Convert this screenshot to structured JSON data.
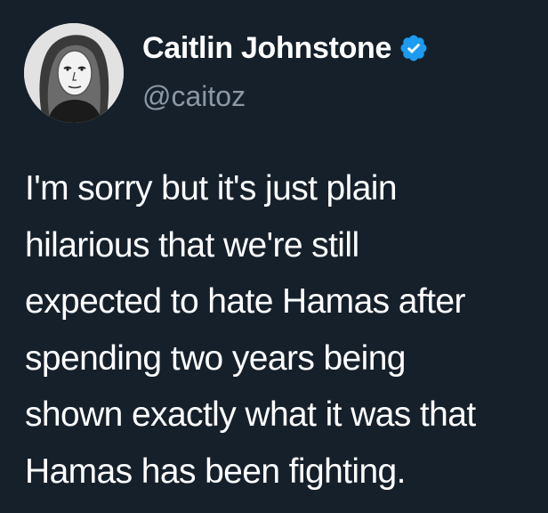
{
  "author": {
    "display_name": "Caitlin Johnstone",
    "handle": "@caitoz",
    "verified_icon": "verified-badge-icon",
    "avatar_icon": "profile-portrait"
  },
  "tweet": {
    "lines": [
      "I'm sorry but it's just plain",
      "hilarious that we're still",
      "expected to hate Hamas after",
      "spending two years being",
      "shown exactly what it was that",
      "Hamas has been fighting."
    ]
  },
  "colors": {
    "background": "#15202b",
    "text": "#ffffff",
    "handle": "#8b98a5",
    "verified": "#1d9bf0"
  }
}
